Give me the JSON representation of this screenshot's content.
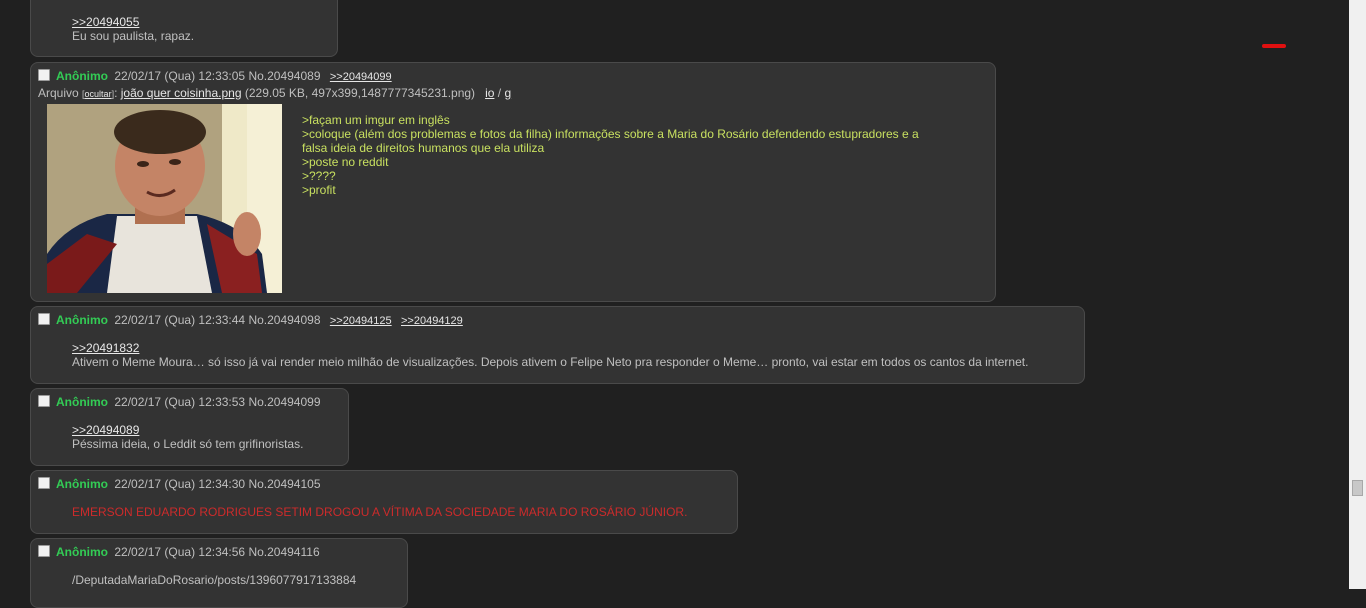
{
  "p0": {
    "quote": ">>20494055",
    "text": "Eu sou paulista, rapaz."
  },
  "p1": {
    "name": "Anônimo",
    "meta": "22/02/17 (Qua) 12:33:05 No.20494089",
    "replies": [
      ">>20494099"
    ],
    "file_label": "Arquivo",
    "file_hide": "ocultar",
    "file_name": "joão quer coisinha.png",
    "file_details": "(229.05 KB, 497x399,1487777345231.png)",
    "file_io": "io",
    "file_g": "g",
    "lines": [
      ">façam um imgur em inglês",
      ">coloque (além dos problemas e fotos da filha) informações sobre a Maria do Rosário defendendo estupradores e a",
      "falsa ideia de direitos humanos que ela utiliza",
      ">poste no reddit",
      ">????",
      ">profit"
    ]
  },
  "p2": {
    "name": "Anônimo",
    "meta": "22/02/17 (Qua) 12:33:44 No.20494098",
    "replies": [
      ">>20494125",
      ">>20494129"
    ],
    "quote": ">>20491832",
    "text": "Ativem o Meme Moura… só isso já vai render meio milhão de visualizações. Depois ativem o Felipe Neto pra responder o Meme… pronto, vai estar em todos os cantos da internet."
  },
  "p3": {
    "name": "Anônimo",
    "meta": "22/02/17 (Qua) 12:33:53 No.20494099",
    "quote": ">>20494089",
    "text": "Péssima ideia, o Leddit só tem grifinoristas."
  },
  "p4": {
    "name": "Anônimo",
    "meta": "22/02/17 (Qua) 12:34:30 No.20494105",
    "text": "EMERSON EDUARDO RODRIGUES SETIM DROGOU A VÍTIMA DA SOCIEDADE MARIA DO ROSÁRIO JÚNIOR."
  },
  "p5": {
    "name": "Anônimo",
    "meta": "22/02/17 (Qua) 12:34:56 No.20494116",
    "text": "/DeputadaMariaDoRosario/posts/1396077917133884"
  },
  "colors": {
    "background": "#202020",
    "post": "#333333",
    "name": "#33cc55",
    "greentext": "#c8e060",
    "redtext": "#cc2b2b"
  }
}
